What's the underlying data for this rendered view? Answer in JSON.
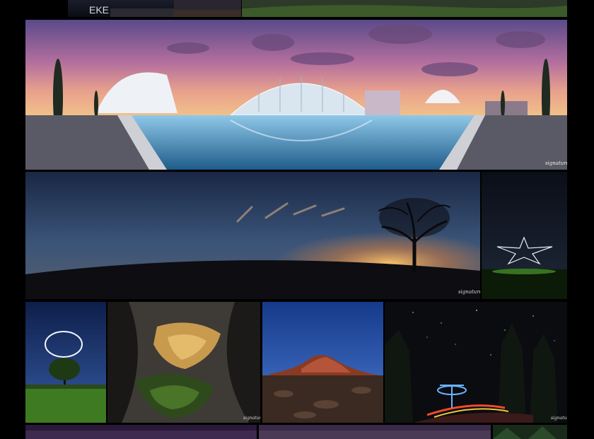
{
  "gallery": {
    "background": "#000000",
    "photos": [
      {
        "id": "top-strip-left",
        "scene": "night-sky-strip",
        "overlay_text": "EKE"
      },
      {
        "id": "top-strip-middle",
        "scene": "dusk-strip"
      },
      {
        "id": "top-strip-right",
        "scene": "green-valley-strip"
      },
      {
        "id": "city-of-arts-panorama",
        "scene": "futuristic-architecture-reflecting-pool-sunset"
      },
      {
        "id": "lone-tree-panorama",
        "scene": "tree-silhouette-sunset-clouds"
      },
      {
        "id": "star-light-painting",
        "scene": "light-painted-star-night-field"
      },
      {
        "id": "light-ring-tree",
        "scene": "light-ring-over-tree-field"
      },
      {
        "id": "lit-cave",
        "scene": "illuminated-rock-cave"
      },
      {
        "id": "volcano",
        "scene": "red-volcano-lava-field-blue-sky"
      },
      {
        "id": "light-figure-forest",
        "scene": "light-painted-figure-forest-stars"
      },
      {
        "id": "bottom-strip-left",
        "scene": "purple-strip"
      },
      {
        "id": "bottom-strip-middle",
        "scene": "purple-strip"
      },
      {
        "id": "bottom-strip-right",
        "scene": "forest-strip"
      }
    ]
  }
}
